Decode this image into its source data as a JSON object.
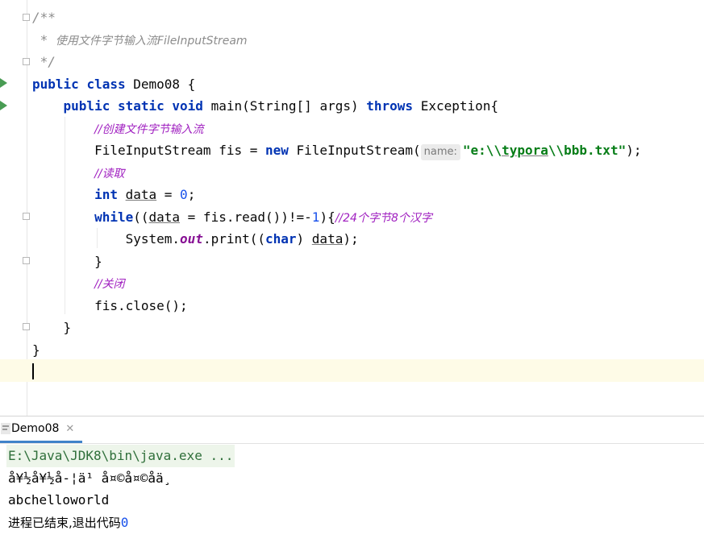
{
  "editor": {
    "doc_open": "/**",
    "doc_star": " * ",
    "doc_text": "使用文件字节输入流FileInputStream",
    "doc_close": " */",
    "kw_public": "public",
    "kw_class": "class",
    "class_name": "Demo08 {",
    "kw_static": "static",
    "kw_void": "void",
    "main_sig": "main(String[] args)",
    "kw_throws": "throws",
    "exception": "Exception{",
    "comment_create": "//创建文件字节输入流",
    "decl_type": "FileInputStream fis = ",
    "kw_new": "new",
    "ctor": "FileInputStream(",
    "param_hint": "name:",
    "str_open": "\"e:\\\\",
    "str_typora": "typora",
    "str_mid": "\\\\bbb.txt\"",
    "ctor_close": ");",
    "comment_read": "//读取",
    "kw_int": "int",
    "var_data": "data",
    "assign": " = ",
    "zero": "0",
    "semi": ";",
    "kw_while": "while",
    "while_open": "((",
    "while_mid": " = fis.read())!=-",
    "one": "1",
    "while_close": "){",
    "comment_24": "//24个字节8个汉字",
    "sys_prefix": "System.",
    "field_out": "out",
    "print_open": ".print((",
    "kw_char": "char",
    "print_sep": ") ",
    "print_close": ");",
    "brace_close": "}",
    "comment_close": "//关闭",
    "fis_close": "fis.close();"
  },
  "run_tab": {
    "label": "Demo08",
    "close_glyph": "✕"
  },
  "console": {
    "command": "E:\\Java\\JDK8\\bin\\java.exe ...",
    "garbled": "å¥½å¥½å-¦ä¹ å¤©å¤©å\u0019\u0019ä¸\u0019",
    "output": "abchelloworld",
    "exit_text": "进程已结束,退出代码",
    "exit_code": "0"
  },
  "colors": {
    "keyword": "#0033b3",
    "string": "#067d17",
    "number": "#1750eb",
    "comment": "#8c8c8c",
    "comment_cn": "#a020c0",
    "caret_row": "#fefbe7",
    "run_icon": "#499c54"
  }
}
